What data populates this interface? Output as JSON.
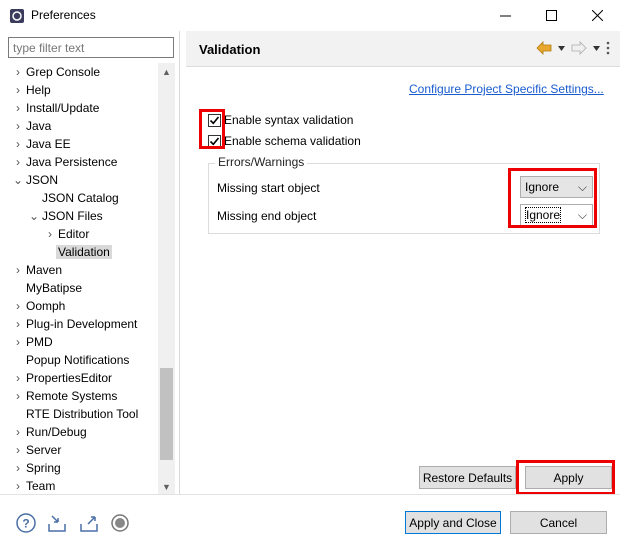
{
  "window": {
    "title": "Preferences"
  },
  "filter": {
    "placeholder": "type filter text"
  },
  "tree": [
    {
      "label": "Grep Console",
      "level": 0,
      "twisty": "collapsed"
    },
    {
      "label": "Help",
      "level": 0,
      "twisty": "collapsed"
    },
    {
      "label": "Install/Update",
      "level": 0,
      "twisty": "collapsed"
    },
    {
      "label": "Java",
      "level": 0,
      "twisty": "collapsed"
    },
    {
      "label": "Java EE",
      "level": 0,
      "twisty": "collapsed"
    },
    {
      "label": "Java Persistence",
      "level": 0,
      "twisty": "collapsed"
    },
    {
      "label": "JSON",
      "level": 0,
      "twisty": "expanded"
    },
    {
      "label": "JSON Catalog",
      "level": 1,
      "twisty": "none"
    },
    {
      "label": "JSON Files",
      "level": 1,
      "twisty": "expanded"
    },
    {
      "label": "Editor",
      "level": 2,
      "twisty": "collapsed"
    },
    {
      "label": "Validation",
      "level": 2,
      "twisty": "none",
      "selected": true
    },
    {
      "label": "Maven",
      "level": 0,
      "twisty": "collapsed"
    },
    {
      "label": "MyBatipse",
      "level": 0,
      "twisty": "none"
    },
    {
      "label": "Oomph",
      "level": 0,
      "twisty": "collapsed"
    },
    {
      "label": "Plug-in Development",
      "level": 0,
      "twisty": "collapsed"
    },
    {
      "label": "PMD",
      "level": 0,
      "twisty": "collapsed"
    },
    {
      "label": "Popup Notifications",
      "level": 0,
      "twisty": "none"
    },
    {
      "label": "PropertiesEditor",
      "level": 0,
      "twisty": "collapsed"
    },
    {
      "label": "Remote Systems",
      "level": 0,
      "twisty": "collapsed"
    },
    {
      "label": "RTE Distribution Tool",
      "level": 0,
      "twisty": "none"
    },
    {
      "label": "Run/Debug",
      "level": 0,
      "twisty": "collapsed"
    },
    {
      "label": "Server",
      "level": 0,
      "twisty": "collapsed"
    },
    {
      "label": "Spring",
      "level": 0,
      "twisty": "collapsed"
    },
    {
      "label": "Team",
      "level": 0,
      "twisty": "collapsed"
    }
  ],
  "page": {
    "title": "Validation",
    "config_link": "Configure Project Specific Settings...",
    "syntax_label": "Enable syntax validation",
    "schema_label": "Enable schema validation",
    "syntax_checked": true,
    "schema_checked": true,
    "group_title": "Errors/Warnings",
    "missing_start_label": "Missing start object",
    "missing_start_value": "Ignore",
    "missing_end_label": "Missing end object",
    "missing_end_value": "Ignore"
  },
  "buttons": {
    "restore": "Restore Defaults",
    "apply": "Apply",
    "apply_close": "Apply and Close",
    "cancel": "Cancel"
  },
  "colors": {
    "link": "#1a5ccf",
    "highlight": "#e00000",
    "accent": "#0078d7",
    "nav_back": "#e8a82e"
  },
  "icons": {
    "bottom": [
      "help-icon",
      "import-icon",
      "export-icon",
      "record-icon"
    ],
    "nav": [
      "back-arrow-icon",
      "dropdown-icon",
      "forward-arrow-icon",
      "dropdown-icon",
      "view-menu-icon"
    ]
  }
}
